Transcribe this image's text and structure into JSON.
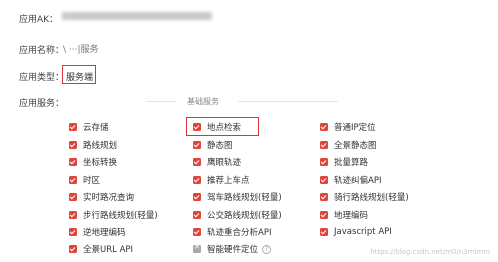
{
  "app_ak": {
    "label": "应用AK："
  },
  "app_name": {
    "label": "应用名称：",
    "value": "\\ ···|服务"
  },
  "app_type": {
    "label": "应用类型：",
    "value": "服务端"
  },
  "services": {
    "label": "应用服务：",
    "section_title": "基础服务"
  },
  "items": [
    "云存储",
    "地点检索",
    "普通IP定位",
    "路线规划",
    "静态图",
    "全景静态图",
    "坐标转换",
    "鹰眼轨迹",
    "批量算路",
    "时区",
    "推荐上车点",
    "轨迹纠偏API",
    "实时路况查询",
    "驾车路线规划(轻量)",
    "骑行路线规划(轻量)",
    "步行路线规划(轻量)",
    "公交路线规划(轻量)",
    "地理编码",
    "逆地理编码",
    "轨迹重合分析API",
    "Javascript API",
    "全景URL API",
    "智能硬件定位"
  ],
  "help_glyph": "?",
  "watermark": "https://blog.csdn.net/m0/n3mlmm"
}
